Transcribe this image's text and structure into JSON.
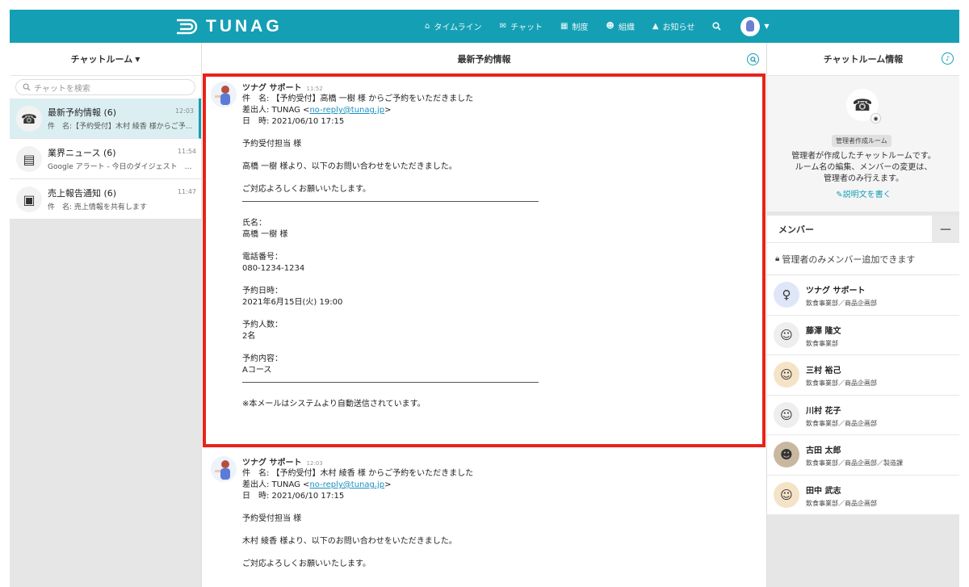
{
  "brand": {
    "name": "TUNAG",
    "accent": "#159fb4"
  },
  "nav": [
    {
      "icon": "home-icon",
      "glyph": "⌂",
      "label": "タイムライン"
    },
    {
      "icon": "chat-icon",
      "glyph": "✉",
      "label": "チャット"
    },
    {
      "icon": "book-icon",
      "glyph": "▦",
      "label": "制度"
    },
    {
      "icon": "organization-icon",
      "glyph": "☻",
      "label": "組織"
    },
    {
      "icon": "bell-icon",
      "glyph": "▲",
      "label": "お知らせ"
    }
  ],
  "left": {
    "header": "チャットルーム",
    "search_placeholder": "チャットを検索",
    "rooms": [
      {
        "title": "最新予約情報 (6)",
        "time": "12:03",
        "sub": "件　名:【予約受付】木村 綾香 様からご予...",
        "icon": "☎"
      },
      {
        "title": "業界ニュース (6)",
        "time": "11:54",
        "sub": "Google アラート - 今日のダイジェスト　2...",
        "icon": "▤"
      },
      {
        "title": "売上報告通知 (6)",
        "time": "11:47",
        "sub": "件　名: 売上情報を共有します",
        "icon": "▣"
      }
    ]
  },
  "center": {
    "header": "最新予約情報",
    "messages": [
      {
        "sender": "ツナグ サポート",
        "time": "11:52",
        "subject": "件　名: 【予約受付】高橋 一樹 様 からご予約をいただきました",
        "from_prefix": "差出人: TUNAG <",
        "from_email": "no-reply@tunag.jp",
        "from_suffix": ">",
        "date": "日　時: 2021/06/10 17:15",
        "greeting": "予約受付担当 様",
        "intro": "高橋 一樹 様より、以下のお問い合わせをいただきました。",
        "closing": "ご対応よろしくお願いいたします。",
        "name_label": "氏名：",
        "name_value": "高橋 一樹 様",
        "phone_label": "電話番号：",
        "phone_value": "080-1234-1234",
        "datetime_label": "予約日時：",
        "datetime_value": "2021年6月15日(火) 19:00",
        "people_label": "予約人数：",
        "people_value": "2名",
        "content_label": "予約内容：",
        "content_value": "Aコース",
        "footer": "※本メールはシステムより自動送信されています。"
      },
      {
        "sender": "ツナグ サポート",
        "time": "12:03",
        "subject": "件　名: 【予約受付】木村 綾香 様 からご予約をいただきました",
        "from_prefix": "差出人: TUNAG <",
        "from_email": "no-reply@tunag.jp",
        "from_suffix": ">",
        "date": "日　時: 2021/06/10 17:15",
        "greeting": "予約受付担当 様",
        "intro": "木村 綾香 様より、以下のお問い合わせをいただきました。",
        "closing": "ご対応よろしくお願いいたします。"
      }
    ]
  },
  "right": {
    "header": "チャットルーム情報",
    "badge": "管理者作成ルーム",
    "desc_lines": [
      "管理者が作成したチャットルームです。",
      "ルーム名の編集、メンバーの変更は、",
      "管理者のみ行えます。"
    ],
    "edit_link": "説明文を書く",
    "members_title": "メンバー",
    "admin_note": "管理者のみメンバー追加できます",
    "members": [
      {
        "name": "ツナグ サポート",
        "dept": "飲食事業部／商品企画部",
        "color": "#dfe6f7",
        "glyph": "♀"
      },
      {
        "name": "藤澤 隆文",
        "dept": "飲食事業部",
        "color": "#eeeeee",
        "glyph": "☺"
      },
      {
        "name": "三村 裕己",
        "dept": "飲食事業部／商品企画部",
        "color": "#f5e3c8",
        "glyph": "☺"
      },
      {
        "name": "川村 花子",
        "dept": "飲食事業部／商品企画部",
        "color": "#eeeeee",
        "glyph": "☺"
      },
      {
        "name": "古田 太郎",
        "dept": "飲食事業部／商品企画部／製造課",
        "color": "#c9b8a0",
        "glyph": "☻"
      },
      {
        "name": "田中 武志",
        "dept": "飲食事業部／商品企画部",
        "color": "#f5e3c8",
        "glyph": "☺"
      }
    ]
  }
}
